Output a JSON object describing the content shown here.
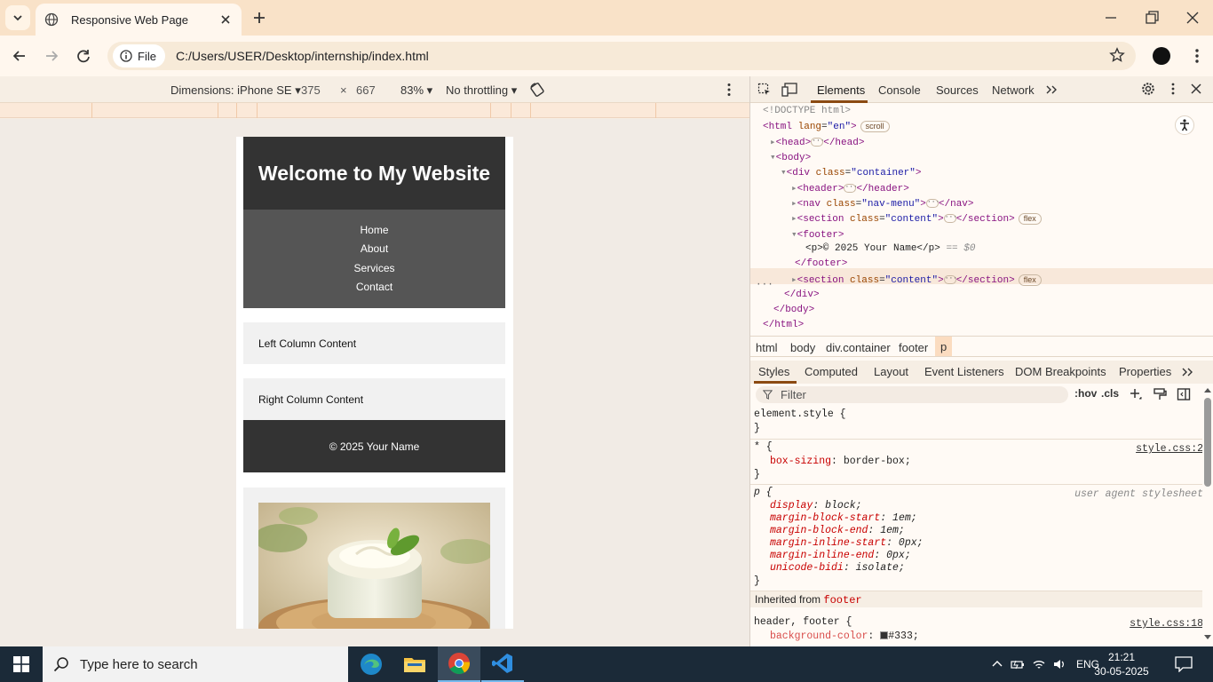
{
  "browser": {
    "tab_title": "Responsive Web Page",
    "omnibox_chip": "File",
    "url": "C:/Users/USER/Desktop/internship/index.html"
  },
  "device_toolbar": {
    "dimensions_label": "Dimensions: iPhone SE",
    "width": "375",
    "times": "×",
    "height": "667",
    "zoom": "83%",
    "throttling": "No throttling"
  },
  "site": {
    "header_title": "Welcome to My Website",
    "nav": [
      "Home",
      "About",
      "Services",
      "Contact"
    ],
    "left_column": "Left Column Content",
    "right_column": "Right Column Content",
    "footer_text": "© 2025 Your Name"
  },
  "devtools": {
    "tabs": [
      "Elements",
      "Console",
      "Sources",
      "Network"
    ],
    "dom": {
      "doctype": "<!DOCTYPE html>",
      "html_open": "<html",
      "lang_attr": "lang",
      "lang_val": "\"en\"",
      "scroll_pill": "scroll",
      "head": "<head>",
      "head_close": "</head>",
      "body": "<body>",
      "div_open": "<div",
      "class_attr": "class",
      "container_val": "\"container\"",
      "header": "<header>",
      "header_close": "</header>",
      "nav_open": "<nav",
      "navmenu_val": "\"nav-menu\"",
      "nav_close": "</nav>",
      "section_open": "<section",
      "content_val": "\"content\"",
      "section_close": "</section>",
      "flex_pill": "flex",
      "footer": "<footer>",
      "p_line": "<p>© 2025 Your Name</p>",
      "eq0": "== $0",
      "footer_close": "</footer>",
      "div_close": "</div>",
      "body_close": "</body>",
      "html_close": "</html>",
      "gt": ">"
    },
    "breadcrumbs": [
      "html",
      "body",
      "div.container",
      "footer",
      "p"
    ],
    "subtabs": [
      "Styles",
      "Computed",
      "Layout",
      "Event Listeners",
      "DOM Breakpoints",
      "Properties"
    ],
    "filter_placeholder": "Filter",
    "hov": ":hov",
    "cls": ".cls",
    "styles": {
      "element_style": "element.style {",
      "close": "}",
      "star_sel": "* {",
      "star_src": "style.css:2",
      "box_sizing": "box-sizing",
      "box_sizing_val": ": border-box;",
      "p_sel": "p {",
      "ua": "user agent stylesheet",
      "ua_props": [
        [
          "display",
          ": block;"
        ],
        [
          "margin-block-start",
          ": 1em;"
        ],
        [
          "margin-block-end",
          ": 1em;"
        ],
        [
          "margin-inline-start",
          ": 0px;"
        ],
        [
          "margin-inline-end",
          ": 0px;"
        ],
        [
          "unicode-bidi",
          ": isolate;"
        ]
      ],
      "inherited": "Inherited from",
      "inherited_from": "footer",
      "hf_sel": "header, footer {",
      "hf_src": "style.css:18",
      "bg_color": "background-color",
      "bg_val": "#333;"
    }
  },
  "taskbar": {
    "search_placeholder": "Type here to search",
    "lang": "ENG",
    "time": "21:21",
    "date": "30-05-2025"
  },
  "colors": {
    "tabstrip": "#f9e2c8",
    "site_dark": "#333333",
    "site_nav": "#555555",
    "devtools_accent": "#8b4a12",
    "taskbar": "#1b2a38"
  }
}
